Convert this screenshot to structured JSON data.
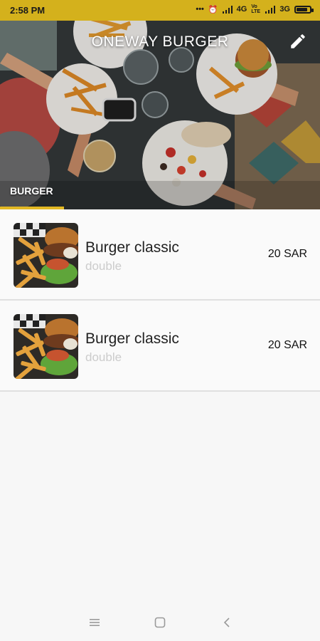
{
  "status_bar": {
    "time": "2:58 PM",
    "signal_left_label": "4G",
    "signal_right_label": "3G",
    "volte_label": "Vo LTE",
    "battery_level": 0.85
  },
  "header": {
    "title": "ONEWAY BURGER",
    "edit_icon": "pencil-icon",
    "category_tab": "BURGER",
    "accent_color": "#e2b824"
  },
  "menu": {
    "items": [
      {
        "name": "Burger classic",
        "variant": "double",
        "price": "20 SAR"
      },
      {
        "name": "Burger classic",
        "variant": "double",
        "price": "20 SAR"
      }
    ]
  },
  "nav": {
    "menu_icon": "menu-icon",
    "home_icon": "home-square-icon",
    "back_icon": "back-chevron-icon"
  }
}
